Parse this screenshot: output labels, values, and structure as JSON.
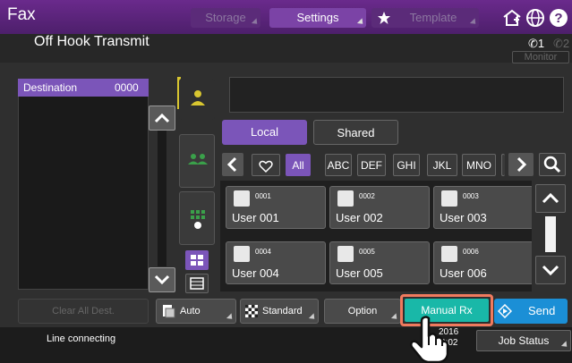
{
  "header": {
    "app_title": "Fax",
    "tabs": [
      {
        "label": "Storage",
        "enabled": false
      },
      {
        "label": "Settings",
        "enabled": true
      },
      {
        "label": "Template",
        "enabled": false
      }
    ],
    "icons": [
      "star-icon",
      "home-icon",
      "globe-icon",
      "help-icon"
    ]
  },
  "subheader": {
    "mode_title": "Off Hook Transmit",
    "line1_label": "1",
    "line2_label": "2",
    "monitor_label": "Monitor"
  },
  "destination_panel": {
    "header_label": "Destination",
    "count": "0000"
  },
  "address_book": {
    "local_label": "Local",
    "shared_label": "Shared",
    "index_buttons": [
      "All",
      "ABC",
      "DEF",
      "GHI",
      "JKL",
      "MNO"
    ],
    "entries": [
      {
        "id": "0001",
        "name": "User 001"
      },
      {
        "id": "0002",
        "name": "User 002"
      },
      {
        "id": "0003",
        "name": "User 003"
      },
      {
        "id": "0004",
        "name": "User 004"
      },
      {
        "id": "0005",
        "name": "User 005"
      },
      {
        "id": "0006",
        "name": "User 006"
      }
    ]
  },
  "bottom_bar": {
    "clear_all_label": "Clear All Dest.",
    "auto_label": "Auto",
    "standard_label": "Standard",
    "option_label": "Option",
    "manual_rx_label": "Manual Rx",
    "send_label": "Send"
  },
  "status_bar": {
    "status_text": "Line connecting",
    "date_fragment": "2016",
    "time_fragment": "0:02",
    "job_status_label": "Job Status"
  },
  "colors": {
    "header_purple": "#5b2b79",
    "accent_purple": "#7b55b9",
    "manual_rx_bg": "#19b8a8",
    "manual_rx_border": "#f07a5e",
    "send_bg": "#1b8fd6",
    "person_icon": "#d8c630"
  }
}
